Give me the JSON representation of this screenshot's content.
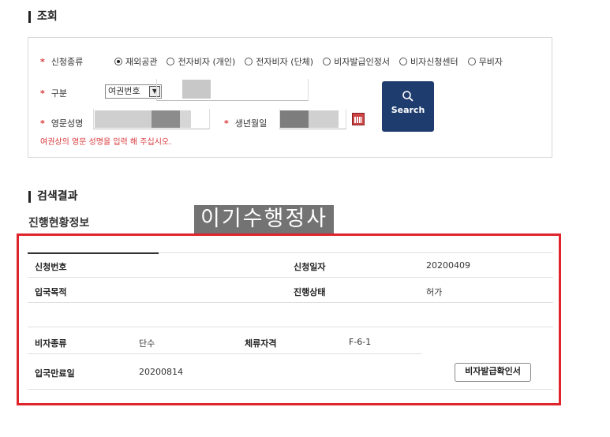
{
  "search_section": {
    "title": "조회",
    "apply_type_label": "신청종류",
    "apply_type_options": [
      "재외공관",
      "전자비자 (개인)",
      "전자비자 (단체)",
      "비자발급인정서",
      "비자신청센터",
      "무비자"
    ],
    "apply_type_selected": "재외공관",
    "category_label": "구분",
    "category_selected": "여권번호",
    "eng_name_label": "영문성명",
    "birth_label": "생년월일",
    "hint": "여권상의 영문 성명을 입력 해 주십시오.",
    "search_button": "Search",
    "accent_color": "#1f3c6e",
    "required_color": "#d9383b"
  },
  "results_section": {
    "title": "검색결과",
    "subtitle": "진행현황정보",
    "watermark": "이기수행정사",
    "highlight_color": "#e0242c",
    "table1": {
      "apply_no_label": "신청번호",
      "apply_no_value": "",
      "apply_date_label": "신청일자",
      "apply_date_value": "20200409",
      "entry_purpose_label": "입국목적",
      "entry_purpose_value": "",
      "status_label": "진행상태",
      "status_value": "허가"
    },
    "table2": {
      "visa_type_label": "비자종류",
      "visa_type_value": "단수",
      "stay_status_label": "체류자격",
      "stay_status_value": "F-6-1",
      "entry_expiry_label": "입국만료일",
      "entry_expiry_value": "20200814",
      "confirm_button": "비자발급확인서"
    }
  }
}
